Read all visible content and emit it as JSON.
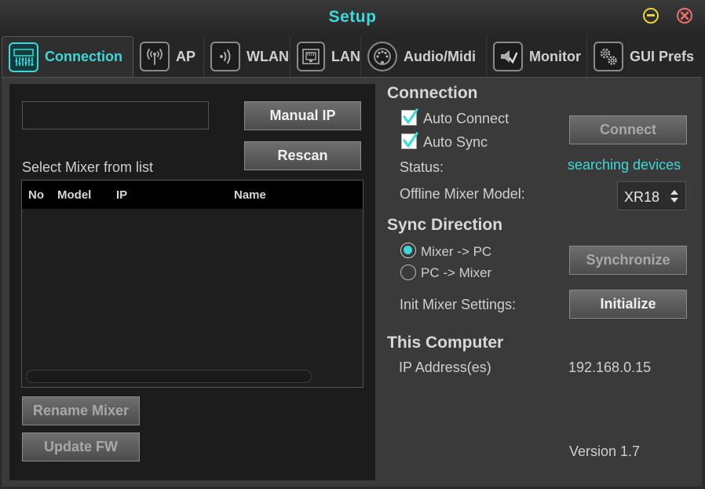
{
  "window": {
    "title": "Setup"
  },
  "tabs": [
    {
      "label": "Connection",
      "icon": "mixer-icon"
    },
    {
      "label": "AP",
      "icon": "antenna-icon"
    },
    {
      "label": "WLAN",
      "icon": "wifi-icon"
    },
    {
      "label": "LAN",
      "icon": "ethernet-icon"
    },
    {
      "label": "Audio/Midi",
      "icon": "midi-port-icon"
    },
    {
      "label": "Monitor",
      "icon": "speaker-check-icon"
    },
    {
      "label": "GUI Prefs",
      "icon": "gears-icon"
    }
  ],
  "left": {
    "ip_input_value": "",
    "manual_ip_label": "Manual IP",
    "rescan_label": "Rescan",
    "select_label": "Select Mixer from list",
    "table_headers": [
      "No",
      "Model",
      "IP",
      "Name"
    ],
    "rows": [],
    "rename_label": "Rename Mixer",
    "update_fw_label": "Update FW"
  },
  "connection": {
    "heading": "Connection",
    "auto_connect": {
      "label": "Auto Connect",
      "checked": true
    },
    "auto_sync": {
      "label": "Auto Sync",
      "checked": true
    },
    "connect_label": "Connect",
    "status_label": "Status:",
    "status_value": "searching devices",
    "offline_label": "Offline Mixer Model:",
    "offline_value": "XR18"
  },
  "sync": {
    "heading": "Sync Direction",
    "option_1": "Mixer -> PC",
    "option_2": "PC -> Mixer",
    "selected": "Mixer -> PC",
    "synchronize_label": "Synchronize",
    "init_label": "Init Mixer Settings:",
    "initialize_label": "Initialize"
  },
  "computer": {
    "heading": "This Computer",
    "ip_label": "IP Address(es)",
    "ip_value": "192.168.0.15",
    "version": "Version 1.7"
  },
  "colors": {
    "accent": "#3fd8d8",
    "minimize": "#e8d33a",
    "close": "#f06f6f",
    "panel": "#1c1c1c",
    "background": "#3a3a3a"
  }
}
